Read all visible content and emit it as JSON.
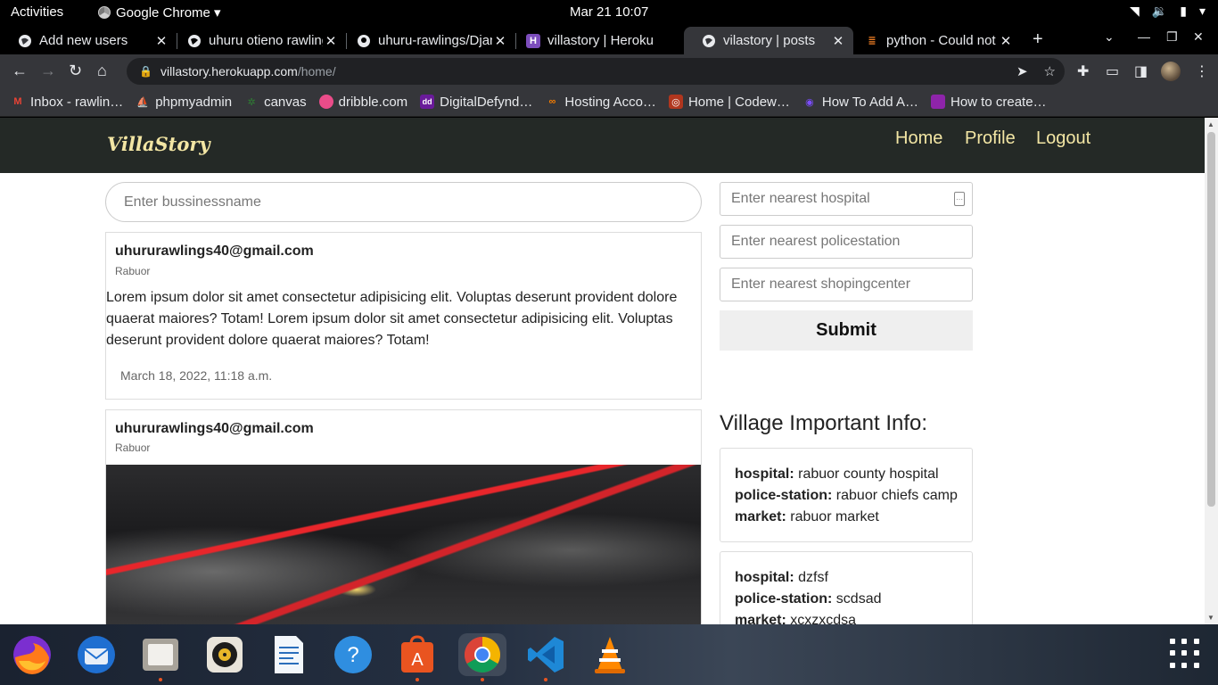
{
  "topbar": {
    "activities": "Activities",
    "app_name": "Google Chrome ▾",
    "clock": "Mar 21  10:07"
  },
  "tabs": [
    {
      "title": "Add new users",
      "favicon": "globe-icon"
    },
    {
      "title": "uhuru otieno rawlings",
      "favicon": "globe-icon"
    },
    {
      "title": "uhuru-rawlings/Django",
      "favicon": "github-icon"
    },
    {
      "title": "villastory | Heroku",
      "favicon": "heroku-icon"
    },
    {
      "title": "vilastory | posts",
      "favicon": "globe-icon",
      "active": true
    },
    {
      "title": "python - Could not",
      "favicon": "stackoverflow-icon"
    }
  ],
  "address": {
    "host": "villastory.herokuapp.com",
    "path": "/home/"
  },
  "bookmarks": [
    {
      "label": "Inbox - rawlin…",
      "icon": "gmail-icon",
      "color": "#ea4335"
    },
    {
      "label": "phpmyadmin",
      "icon": "phpmyadmin-icon",
      "color": "#f0a30a"
    },
    {
      "label": "canvas",
      "icon": "tree-icon",
      "color": "#2e7d32"
    },
    {
      "label": "dribble.com",
      "icon": "dribbble-icon",
      "color": "#ea4c89"
    },
    {
      "label": "DigitalDefynd…",
      "icon": "dd-icon",
      "color": "#6a1b9a"
    },
    {
      "label": "Hosting Acco…",
      "icon": "hosting-icon",
      "color": "#f57c00"
    },
    {
      "label": "Home | Codew…",
      "icon": "codewars-icon",
      "color": "#b1361e"
    },
    {
      "label": "How To Add A…",
      "icon": "spiral-icon",
      "color": "#7c4dff"
    },
    {
      "label": "How to create…",
      "icon": "bookmark-icon",
      "color": "#8e24aa"
    }
  ],
  "site": {
    "brand": "VillaStory",
    "nav": [
      "Home",
      "Profile",
      "Logout"
    ],
    "search_placeholder": "Enter bussinessname"
  },
  "posts": [
    {
      "email": "uhururawlings40@gmail.com",
      "location": "Rabuor",
      "body": "Lorem ipsum dolor sit amet consectetur adipisicing elit. Voluptas deserunt provident dolore quaerat maiores? Totam! Lorem ipsum dolor sit amet consectetur adipisicing elit. Voluptas deserunt provident dolore quaerat maiores? Totam!",
      "date": "March 18, 2022, 11:18 a.m."
    },
    {
      "email": "uhururawlings40@gmail.com",
      "location": "Rabuor"
    }
  ],
  "form": {
    "hospital_placeholder": "Enter nearest hospital",
    "police_placeholder": "Enter nearest policestation",
    "shopping_placeholder": "Enter nearest shopingcenter",
    "submit": "Submit"
  },
  "info": {
    "heading": "Village Important Info:",
    "labels": {
      "hospital": "hospital:",
      "police": "police-station:",
      "market": "market:"
    },
    "cards": [
      {
        "hospital": "rabuor county hospital",
        "police": "rabuor chiefs camp",
        "market": "rabuor market"
      },
      {
        "hospital": "dzfsf",
        "police": "scdsad",
        "market": "xcxzxcdsa"
      }
    ]
  },
  "dock": [
    "firefox-icon",
    "thunderbird-icon",
    "files-icon",
    "rhythmbox-icon",
    "libreoffice-writer-icon",
    "help-icon",
    "software-center-icon",
    "chrome-icon",
    "vscode-icon",
    "vlc-icon"
  ]
}
